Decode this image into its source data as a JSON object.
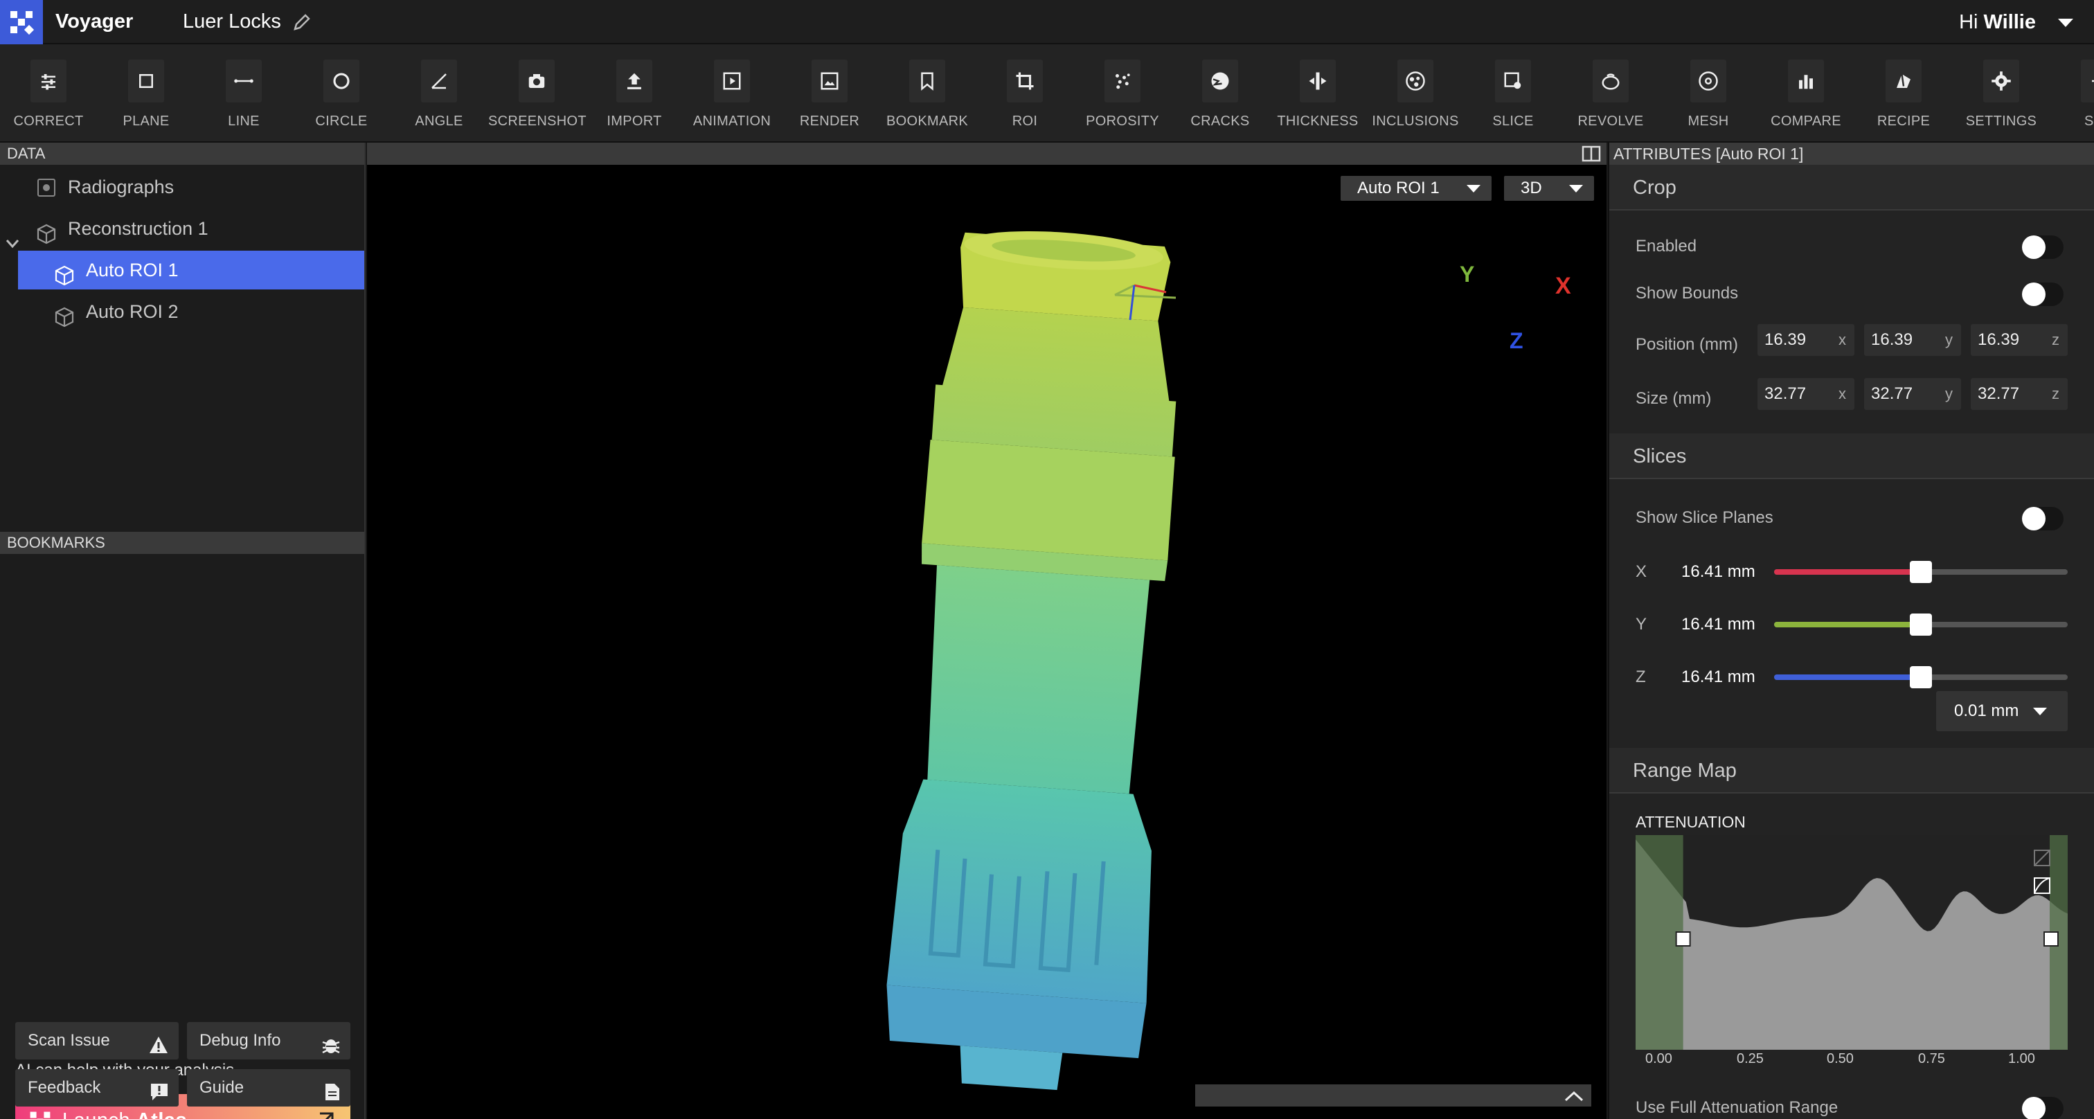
{
  "app": {
    "name": "Voyager",
    "project": "Luer Locks",
    "greeting": "Hi",
    "user": "Willie"
  },
  "toolbar": [
    {
      "label": "CORRECT",
      "icon": "sliders-icon"
    },
    {
      "label": "PLANE",
      "icon": "square-icon"
    },
    {
      "label": "LINE",
      "icon": "line-measure-icon"
    },
    {
      "label": "CIRCLE",
      "icon": "circle-icon"
    },
    {
      "label": "ANGLE",
      "icon": "angle-icon"
    },
    {
      "label": "SCREENSHOT",
      "icon": "camera-icon"
    },
    {
      "label": "IMPORT",
      "icon": "upload-icon"
    },
    {
      "label": "ANIMATION",
      "icon": "play-box-icon"
    },
    {
      "label": "RENDER",
      "icon": "image-icon"
    },
    {
      "label": "BOOKMARK",
      "icon": "bookmark-icon"
    },
    {
      "label": "ROI",
      "icon": "crop-icon"
    },
    {
      "label": "POROSITY",
      "icon": "dots-icon"
    },
    {
      "label": "CRACKS",
      "icon": "cracks-icon"
    },
    {
      "label": "THICKNESS",
      "icon": "thickness-icon"
    },
    {
      "label": "INCLUSIONS",
      "icon": "inclusions-icon"
    },
    {
      "label": "SLICE",
      "icon": "slice-icon"
    },
    {
      "label": "REVOLVE",
      "icon": "revolve-icon"
    },
    {
      "label": "MESH",
      "icon": "mesh-icon"
    },
    {
      "label": "COMPARE",
      "icon": "bar-chart-icon"
    },
    {
      "label": "RECIPE",
      "icon": "recipe-icon"
    },
    {
      "label": "SETTINGS",
      "icon": "gear-icon"
    },
    {
      "label": "SHA",
      "icon": "share-icon"
    }
  ],
  "left": {
    "data_header": "DATA",
    "tree": [
      {
        "label": "Radiographs",
        "level": 0
      },
      {
        "label": "Reconstruction 1",
        "level": 0
      },
      {
        "label": "Auto ROI 1",
        "level": 1,
        "selected": true
      },
      {
        "label": "Auto ROI 2",
        "level": 1
      }
    ],
    "bookmarks_header": "BOOKMARKS",
    "ai_help": "AI can help with your analysis.",
    "launch_prefix": "Launch",
    "launch_bold": "Atlas",
    "buttons": {
      "scan_issue": "Scan Issue",
      "debug_info": "Debug Info",
      "feedback": "Feedback",
      "guide": "Guide"
    }
  },
  "viewport": {
    "roi_select": "Auto ROI 1",
    "mode_select": "3D",
    "axes": {
      "x": "X",
      "y": "Y",
      "z": "Z"
    }
  },
  "attributes": {
    "header": "ATTRIBUTES [Auto ROI 1]",
    "crop": {
      "title": "Crop",
      "enabled_label": "Enabled",
      "enabled": false,
      "show_bounds_label": "Show Bounds",
      "show_bounds": false,
      "position_label": "Position (mm)",
      "position": {
        "x": "16.39",
        "y": "16.39",
        "z": "16.39"
      },
      "size_label": "Size (mm)",
      "size": {
        "x": "32.77",
        "y": "32.77",
        "z": "32.77"
      },
      "axis_letters": {
        "x": "x",
        "y": "y",
        "z": "z"
      }
    },
    "slices": {
      "title": "Slices",
      "show_label": "Show Slice Planes",
      "show": false,
      "rows": [
        {
          "axis": "X",
          "value": "16.41 mm",
          "fraction": 0.5,
          "color": "#d8344f"
        },
        {
          "axis": "Y",
          "value": "16.41 mm",
          "fraction": 0.5,
          "color": "#8cb43c"
        },
        {
          "axis": "Z",
          "value": "16.41 mm",
          "fraction": 0.5,
          "color": "#3f5fd8"
        }
      ],
      "step": "0.01 mm"
    },
    "range_map": {
      "title": "Range Map",
      "chart_label": "ATTENUATION",
      "ticks": [
        "0.00",
        "0.25",
        "0.50",
        "0.75",
        "1.00"
      ],
      "range": [
        0.11,
        1.0
      ],
      "full_range_label": "Use Full Attenuation Range",
      "full_range": false
    }
  },
  "colors": {
    "accent": "#4a6aea",
    "brand": "#3d5bd9"
  }
}
